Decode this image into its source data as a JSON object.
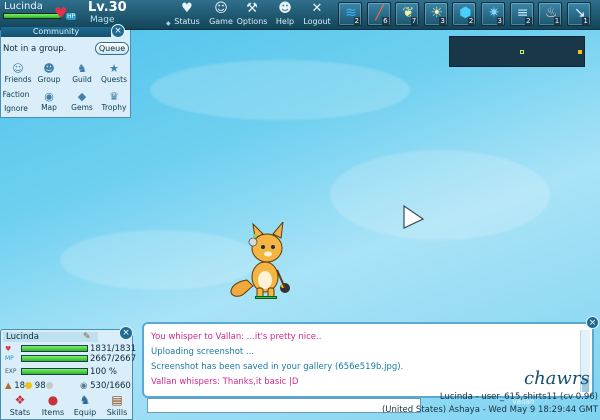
{
  "player": {
    "name": "Lucinda",
    "level": "Lv.30",
    "class": "Mage",
    "hp_fraction": 1.0,
    "hp_tag": "HP"
  },
  "topnav": [
    {
      "label": "Status",
      "icon": "heart-icon"
    },
    {
      "label": "Game",
      "icon": "person-icon"
    },
    {
      "label": "Options",
      "icon": "wrench-icon"
    },
    {
      "label": "Help",
      "icon": "help-person-icon"
    },
    {
      "label": "Logout",
      "icon": "x-icon"
    }
  ],
  "skills": [
    {
      "count": "2",
      "icon": "wave-icon",
      "color": "#3bb4ff"
    },
    {
      "count": "6",
      "icon": "fire-slash-icon",
      "color": "#ff6a3d"
    },
    {
      "count": "7",
      "icon": "leaf-icon",
      "color": "#f2f0a0"
    },
    {
      "count": "3",
      "icon": "light-icon",
      "color": "#f5f0b8"
    },
    {
      "count": "2",
      "icon": "crest-icon",
      "color": "#49d0ff"
    },
    {
      "count": "3",
      "icon": "spark-icon",
      "color": "#7fd7ff"
    },
    {
      "count": "2",
      "icon": "scroll-icon",
      "color": "#bfe8ff"
    },
    {
      "count": "1",
      "icon": "flame-icon",
      "color": "#ffd2a0"
    },
    {
      "count": "1",
      "icon": "arrow-icon",
      "color": "#e8f4ff"
    }
  ],
  "community": {
    "title": "Community",
    "group_status": "Not in a group.",
    "queue_label": "Queue",
    "buttons": [
      {
        "label": "Friends",
        "icon": "friends-icon"
      },
      {
        "label": "Group",
        "icon": "group-icon"
      },
      {
        "label": "Guild",
        "icon": "guild-icon"
      },
      {
        "label": "Quests",
        "icon": "quests-icon"
      },
      {
        "label": "Faction",
        "icon": "faction-icon"
      },
      {
        "label": "Map",
        "icon": "map-icon"
      },
      {
        "label": "Gems",
        "icon": "gems-icon"
      },
      {
        "label": "Trophy",
        "icon": "trophy-icon"
      },
      {
        "label": "Ignore",
        "icon": ""
      }
    ]
  },
  "minimap": {
    "player_dot_color": "#c9f06a",
    "npc_dot_color": "#f2c21a"
  },
  "character_panel": {
    "name": "Lucinda",
    "hp": "1831/1831",
    "mp": "2667/2667",
    "exp": "100 %",
    "exp_label": "EXP",
    "hp_fraction": 1.0,
    "mp_fraction": 1.0,
    "exp_fraction": 1.0,
    "gold": "18",
    "silver": "98",
    "copper": "",
    "weight": "530/1660",
    "buttons": [
      {
        "label": "Stats",
        "icon": "sword-icon"
      },
      {
        "label": "Items",
        "icon": "items-icon"
      },
      {
        "label": "Equip",
        "icon": "equip-icon"
      },
      {
        "label": "Skills",
        "icon": "book-icon"
      }
    ]
  },
  "chat": {
    "lines": [
      {
        "text": "You whisper to Vallan: ...it's pretty nice..",
        "color": "#d12a8a"
      },
      {
        "text": "Uploading screenshot ...",
        "color": "#1b7aa6"
      },
      {
        "text": "Screenshot has been saved in your gallery (656e519b.jpg).",
        "color": "#1b7aa6"
      },
      {
        "text": "Vallan whispers: Thanks,it basic |D",
        "color": "#d12a8a"
      }
    ],
    "input_value": "",
    "logo": "chawrs",
    "tag": "Vallan",
    "info_1": "Lucinda - user_615,shirts11 (cv 0.96)",
    "info_2": "(United States) Ashaya - Wed May 9 18:29:44 GMT"
  }
}
